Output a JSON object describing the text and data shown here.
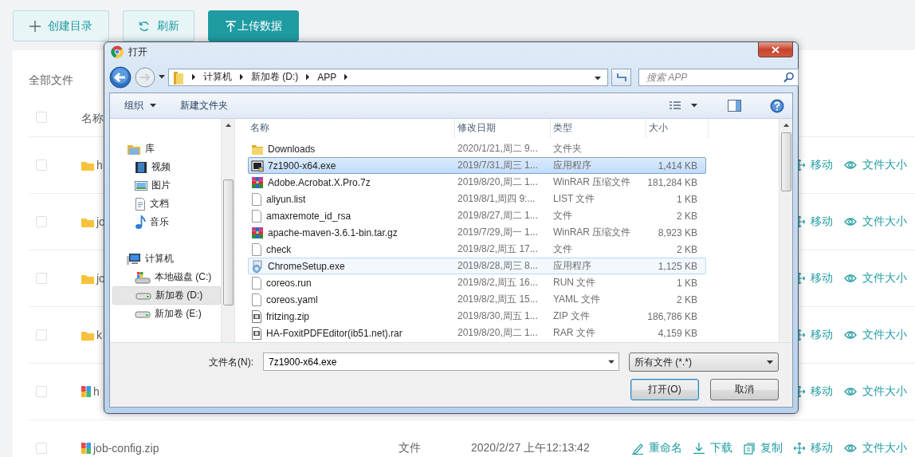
{
  "toolbar": {
    "buttons": [
      {
        "kind": "create",
        "label": "创建目录",
        "primary": false
      },
      {
        "kind": "refresh",
        "label": "刷新",
        "primary": false
      },
      {
        "kind": "upload",
        "label": "上传数据",
        "primary": true
      }
    ]
  },
  "panel": {
    "title": "全部文件",
    "header": {
      "checked": false,
      "name": "名称"
    },
    "rows": [
      {
        "kind": "folder",
        "name": "h",
        "checked": false,
        "actions": [
          {
            "kind": "move",
            "label": "移动"
          },
          {
            "kind": "size",
            "label": "文件大小"
          }
        ]
      },
      {
        "kind": "folder",
        "name": "jo",
        "checked": false,
        "actions": [
          {
            "kind": "move",
            "label": "移动"
          },
          {
            "kind": "size",
            "label": "文件大小"
          }
        ]
      },
      {
        "kind": "folder",
        "name": "jo",
        "checked": false,
        "actions": [
          {
            "kind": "move",
            "label": "移动"
          },
          {
            "kind": "size",
            "label": "文件大小"
          }
        ]
      },
      {
        "kind": "folder",
        "name": "k",
        "checked": false,
        "actions": [
          {
            "kind": "move",
            "label": "移动"
          },
          {
            "kind": "size",
            "label": "文件大小"
          }
        ]
      },
      {
        "kind": "zip",
        "name": "h",
        "checked": false,
        "actions": [
          {
            "kind": "move",
            "label": "移动"
          },
          {
            "kind": "size",
            "label": "文件大小"
          }
        ]
      },
      {
        "kind": "zip",
        "name": "job-config.zip",
        "type": "文件",
        "date": "2020/2/27 上午12:13:42",
        "checked": false,
        "actions": [
          {
            "kind": "rename",
            "label": "重命名"
          },
          {
            "kind": "download",
            "label": "下载"
          },
          {
            "kind": "copy",
            "label": "复制"
          },
          {
            "kind": "move",
            "label": "移动"
          },
          {
            "kind": "size",
            "label": "文件大小"
          }
        ]
      }
    ]
  },
  "dialog": {
    "title": "打开",
    "breadcrumb": [
      "计算机",
      "新加卷 (D:)",
      "APP"
    ],
    "search": {
      "placeholder": "搜索 APP"
    },
    "toolbar": {
      "organize": "组织",
      "new_folder": "新建文件夹"
    },
    "nav": [
      {
        "label": "库",
        "kind": "library",
        "selected": false,
        "children": [
          {
            "label": "视频",
            "kind": "video",
            "selected": false
          },
          {
            "label": "图片",
            "kind": "picture",
            "selected": false
          },
          {
            "label": "文档",
            "kind": "document",
            "selected": false
          },
          {
            "label": "音乐",
            "kind": "music",
            "selected": false
          }
        ]
      },
      {
        "label": "计算机",
        "kind": "computer",
        "selected": false,
        "children": [
          {
            "label": "本地磁盘 (C:)",
            "kind": "system-drive",
            "selected": false
          },
          {
            "label": "新加卷 (D:)",
            "kind": "drive",
            "selected": true
          },
          {
            "label": "新加卷 (E:)",
            "kind": "drive",
            "selected": false
          }
        ]
      }
    ],
    "columns": [
      "名称",
      "修改日期",
      "类型",
      "大小"
    ],
    "files": [
      {
        "kind": "folder",
        "name": "Downloads",
        "date": "2020/1/21,周二 9...",
        "type": "文件夹",
        "selected": false,
        "hover": false
      },
      {
        "kind": "app",
        "name": "7z1900-x64.exe",
        "date": "2019/7/31,周三 1...",
        "type": "应用程序",
        "size": "1,414 KB",
        "selected": true,
        "hover": false
      },
      {
        "kind": "archive",
        "name": "Adobe.Acrobat.X.Pro.7z",
        "date": "2019/8/20,周二 1...",
        "type": "WinRAR 压缩文件",
        "size": "181,284 KB",
        "selected": false,
        "hover": false
      },
      {
        "kind": "file",
        "name": "aliyun.list",
        "date": "2019/8/1,周四 9:...",
        "type": "LIST 文件",
        "size": "1 KB",
        "selected": false,
        "hover": false
      },
      {
        "kind": "file",
        "name": "amaxremote_id_rsa",
        "date": "2019/8/27,周二 1...",
        "type": "文件",
        "size": "2 KB",
        "selected": false,
        "hover": false
      },
      {
        "kind": "archive",
        "name": "apache-maven-3.6.1-bin.tar.gz",
        "date": "2019/7/29,周一 1...",
        "type": "WinRAR 压缩文件",
        "size": "8,923 KB",
        "selected": false,
        "hover": false
      },
      {
        "kind": "file",
        "name": "check",
        "date": "2019/8/2,周五 17...",
        "type": "文件",
        "size": "2 KB",
        "selected": false,
        "hover": false
      },
      {
        "kind": "installer",
        "name": "ChromeSetup.exe",
        "date": "2019/8/28,周三 8...",
        "type": "应用程序",
        "size": "1,125 KB",
        "selected": false,
        "hover": true
      },
      {
        "kind": "file",
        "name": "coreos.run",
        "date": "2019/8/2,周五 16...",
        "type": "RUN 文件",
        "size": "1 KB",
        "selected": false,
        "hover": false
      },
      {
        "kind": "file",
        "name": "coreos.yaml",
        "date": "2019/8/2,周五 15...",
        "type": "YAML 文件",
        "size": "2 KB",
        "selected": false,
        "hover": false
      },
      {
        "kind": "zip",
        "name": "fritzing.zip",
        "date": "2019/8/30,周五 1...",
        "type": "ZIP 文件",
        "size": "186,786 KB",
        "selected": false,
        "hover": false
      },
      {
        "kind": "zip",
        "name": "HA-FoxitPDFEditor(ib51.net).rar",
        "date": "2019/8/20,周二 1...",
        "type": "RAR 文件",
        "size": "4,159 KB",
        "selected": false,
        "hover": false
      }
    ],
    "file_name": {
      "label": "文件名(N):",
      "value": "7z1900-x64.exe"
    },
    "filter": "所有文件 (*.*)",
    "buttons": [
      {
        "label": "打开(O)",
        "default": true
      },
      {
        "label": "取消",
        "default": false
      }
    ]
  }
}
